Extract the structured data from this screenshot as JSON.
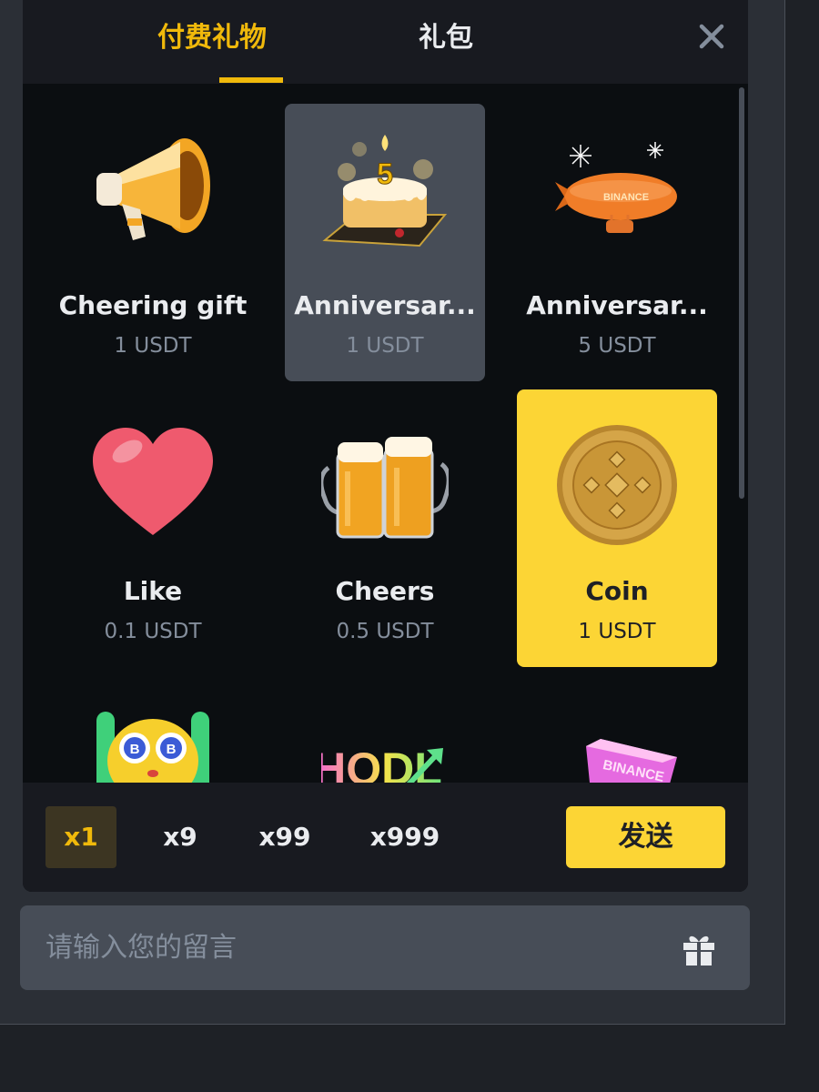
{
  "tabs": [
    {
      "label": "付费礼物",
      "active": true
    },
    {
      "label": "礼包",
      "active": false
    }
  ],
  "close_icon": "close-icon",
  "gifts": [
    {
      "name": "Cheering gift",
      "price": "1 USDT",
      "icon": "megaphone-icon",
      "selected": "none"
    },
    {
      "name": "Anniversar...",
      "price": "1 USDT",
      "icon": "anniversary-cake-icon",
      "selected": "gray"
    },
    {
      "name": "Anniversar...",
      "price": "5 USDT",
      "icon": "binance-blimp-icon",
      "selected": "none"
    },
    {
      "name": "Like",
      "price": "0.1 USDT",
      "icon": "heart-icon",
      "selected": "none"
    },
    {
      "name": "Cheers",
      "price": "0.5 USDT",
      "icon": "beer-mugs-icon",
      "selected": "none"
    },
    {
      "name": "Coin",
      "price": "1 USDT",
      "icon": "bnb-coin-icon",
      "selected": "yellow"
    },
    {
      "name": "",
      "price": "",
      "icon": "bitcoin-face-icon",
      "selected": "none"
    },
    {
      "name": "",
      "price": "",
      "icon": "hodl-icon",
      "selected": "none"
    },
    {
      "name": "",
      "price": "",
      "icon": "binance-block-icon",
      "selected": "none"
    }
  ],
  "art_text": {
    "cake_number": "5",
    "blimp_label": "BINANCE",
    "hodl_text": "HODL",
    "block_label": "BINANCE",
    "btc_symbol": "B"
  },
  "quantities": [
    {
      "label": "x1",
      "active": true
    },
    {
      "label": "x9",
      "active": false
    },
    {
      "label": "x99",
      "active": false
    },
    {
      "label": "x999",
      "active": false
    }
  ],
  "send_label": "发送",
  "message": {
    "placeholder": "请输入您的留言",
    "value": ""
  },
  "colors": {
    "accent": "#f0b90b",
    "selected_card": "#fcd535",
    "card_hover": "#474d57",
    "panel": "#0b0e11"
  }
}
